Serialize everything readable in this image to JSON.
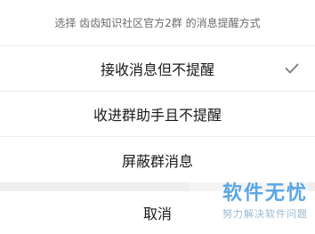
{
  "sheet": {
    "title": "选择 齿齿知识社区官方2群 的消息提醒方式",
    "options": [
      {
        "label": "接收消息但不提醒",
        "selected": true,
        "icon": "check-icon"
      },
      {
        "label": "收进群助手且不提醒",
        "selected": false
      },
      {
        "label": "屏蔽群消息",
        "selected": false
      }
    ],
    "cancel_label": "取消"
  },
  "watermark": {
    "main": "软件无忧",
    "sub": "努力解决软件问题"
  },
  "colors": {
    "check": "#7a7a7a",
    "watermark_main": "#5aa7e6",
    "watermark_sub": "#9bb8cf"
  }
}
